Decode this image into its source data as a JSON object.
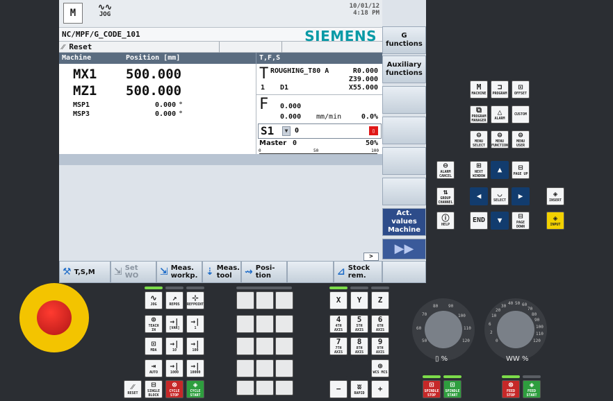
{
  "header": {
    "mode_icon": "M",
    "mode_label": "JOG",
    "date": "10/01/12",
    "time": "4:18 PM"
  },
  "program_path": "NC/MPF/G_CODE_101",
  "brand": "SIEMENS",
  "channel_status": "Reset",
  "columns": {
    "machine": "Machine",
    "position": "Position [mm]",
    "tfs": "T,F,S"
  },
  "axes": [
    {
      "name": "MX1",
      "value": "500.000",
      "unit": ""
    },
    {
      "name": "MZ1",
      "value": "500.000",
      "unit": ""
    },
    {
      "name": "MSP1",
      "value": "0.000",
      "unit": "°"
    },
    {
      "name": "MSP3",
      "value": "0.000",
      "unit": "°"
    }
  ],
  "tool": {
    "letter": "T",
    "name": "ROUGHING_T80 A",
    "r_offset": "R0.000",
    "z_offset": "Z39.000",
    "edge": "1",
    "d": "D1",
    "x_offset": "X55.000"
  },
  "feed": {
    "letter": "F",
    "value1": "0.000",
    "value2": "0.000",
    "unit": "mm/min",
    "override": "0.0%"
  },
  "spindle": {
    "name": "S1",
    "value": "0",
    "master_label": "Master",
    "master_value": "0",
    "override": "50%",
    "gauge_ticks": [
      "0",
      "50",
      "100"
    ]
  },
  "vertical_softkeys": [
    {
      "line1": "G",
      "line2": "functions"
    },
    {
      "line1": "Auxiliary",
      "line2": "functions"
    },
    {
      "line1": "",
      "line2": ""
    },
    {
      "line1": "",
      "line2": ""
    },
    {
      "line1": "",
      "line2": ""
    },
    {
      "line1": "",
      "line2": ""
    },
    {
      "line1": "Act. values",
      "line2": "Machine"
    },
    {
      "line1": "▶▶",
      "line2": ""
    }
  ],
  "horizontal_softkeys": [
    {
      "l1": "T,S,M",
      "l2": ""
    },
    {
      "l1": "Set",
      "l2": "WO"
    },
    {
      "l1": "Meas.",
      "l2": "workp."
    },
    {
      "l1": "Meas.",
      "l2": "tool"
    },
    {
      "l1": "Posi-",
      "l2": "tion"
    },
    {
      "l1": "Stock",
      "l2": "rem."
    }
  ],
  "scroll_label": ">",
  "nav_keys": {
    "machine": "MACHINE",
    "program": "PROGRAM",
    "offset": "OFFSET",
    "program_manager": "PROGRAM MANAGER",
    "alarm": "ALARM",
    "custom": "CUSTOM",
    "menu_select": "MENU SELECT",
    "menu_function": "MENU FUNCTION",
    "menu_user": "MENU USER",
    "alarm_cancel": "ALARM CANCEL",
    "next_window": "NEXT WINDOW",
    "page_up": "PAGE UP",
    "group_channel": "GROUP CHANNEL",
    "select": "SELECT",
    "insert": "INSERT",
    "help": "HELP",
    "end": "END",
    "page_down": "PAGE DOWN",
    "input": "INPUT"
  },
  "jog_keys": {
    "jog": "JOG",
    "repos": "REPOS",
    "refpoint": "REFPOINT",
    "teach_in": "TEACH IN",
    "var": "[VAR]",
    "inc1": "1",
    "mda": "MDA",
    "inc10": "10",
    "inc100": "100",
    "auto": "AUTO",
    "inc1000": "1000",
    "inc10000": "10000",
    "reset": "RESET",
    "single_block": "SINGLE BLOCK",
    "cycle_stop": "CYCLE STOP",
    "cycle_start": "CYCLE START"
  },
  "axis_keys": {
    "x": "X",
    "y": "Y",
    "z": "Z",
    "a4": "4",
    "a4l": "4TH AXIS",
    "a5": "5",
    "a5l": "5TH AXIS",
    "a6": "6",
    "a6l": "6TH AXIS",
    "a7": "7",
    "a7l": "7TH AXIS",
    "a8": "8",
    "a8l": "8TH AXIS",
    "a9": "9",
    "a9l": "9TH AXIS",
    "wcs": "WCS MCS",
    "minus": "−",
    "rapid": "RAPID",
    "plus": "+"
  },
  "spindle_keys": {
    "stop": "SPINDLE STOP",
    "start": "SPINDLE START"
  },
  "feed_keys": {
    "stop": "FEED STOP",
    "start": "FEED START"
  },
  "dials": {
    "spindle_label": "▯ %",
    "spindle_ticks": [
      "50",
      "60",
      "70",
      "80",
      "90",
      "100",
      "110",
      "120"
    ],
    "feed_label": "WW %",
    "feed_ticks": [
      "0",
      "2",
      "6",
      "10",
      "20",
      "30",
      "40",
      "50",
      "60",
      "70",
      "80",
      "90",
      "100",
      "110",
      "120"
    ]
  }
}
